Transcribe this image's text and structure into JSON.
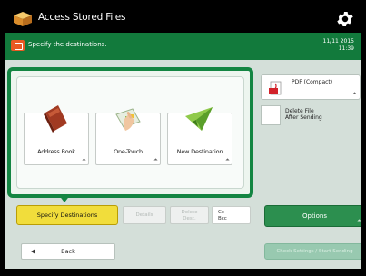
{
  "header": {
    "title": "Access Stored Files",
    "app_icon": "box-icon",
    "settings_icon": "gear-icon"
  },
  "status": {
    "message": "Specify the destinations.",
    "date": "11/11 2015",
    "time": "11:39",
    "message_icon": "envelope-icon"
  },
  "destinations": {
    "address_book": "Address Book",
    "one_touch": "One-Touch",
    "new_destination": "New Destination"
  },
  "file_format": {
    "label": "PDF (Compact)",
    "icon": "pdf-icon"
  },
  "delete_after_send": {
    "label": "Delete File\nAfter Sending",
    "checked": false
  },
  "actions": {
    "specify": "Specify Destinations",
    "details": "Details",
    "delete_dest": "Delete\nDest.",
    "cc_bcc": "Cc\nBcc",
    "options": "Options",
    "back": "Back",
    "start": "Check Settings / Start Sending"
  },
  "colors": {
    "accent": "#127a3c",
    "selected": "#f1dd3b",
    "status_icon": "#e95a24"
  }
}
